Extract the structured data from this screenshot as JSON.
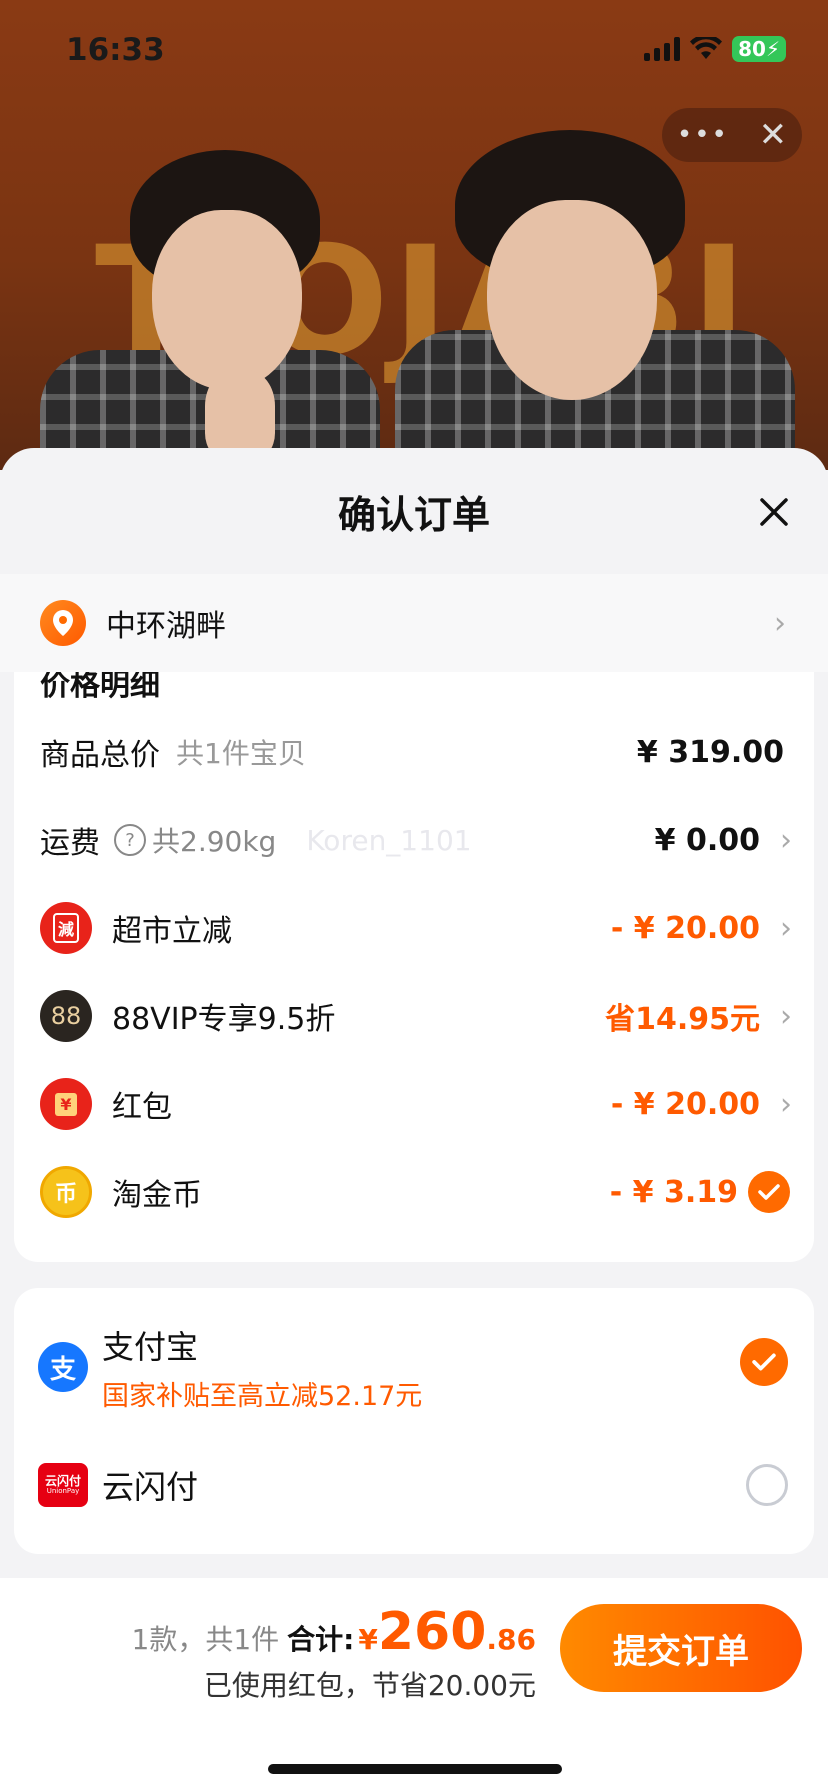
{
  "status_bar": {
    "time": "16:33",
    "battery": "80"
  },
  "hero": {
    "poster_text": "TIOJABI"
  },
  "sheet": {
    "title": "确认订单"
  },
  "address": {
    "text": "中环湖畔"
  },
  "price_detail": {
    "heading": "价格明细",
    "goods_total": {
      "label": "商品总价",
      "sub": "共1件宝贝",
      "value": "¥ 319.00"
    },
    "shipping": {
      "label": "运费",
      "sub": "共2.90kg",
      "watermark": "Koren_1101",
      "value": "¥ 0.00"
    },
    "discounts": [
      {
        "icon": "supermarket-discount-icon",
        "badge": "減",
        "label": "超市立减",
        "value": "- ¥ 20.00"
      },
      {
        "icon": "88vip-icon",
        "badge": "88",
        "label": "88VIP专享9.5折",
        "value": "省14.95元"
      },
      {
        "icon": "red-envelope-icon",
        "badge": "¥",
        "label": "红包",
        "value": "- ¥ 20.00"
      }
    ],
    "coins": {
      "label": "淘金币",
      "value": "- ¥ 3.19"
    }
  },
  "payment": {
    "alipay": {
      "name": "支付宝",
      "sub": "国家补贴至高立减52.17元",
      "icon_char": "支"
    },
    "unionpay": {
      "name": "云闪付",
      "icon_text": "云闪付",
      "icon_sub": "UnionPay"
    }
  },
  "footer": {
    "count": "1款，共1件",
    "total_label": "合计:",
    "currency": "¥",
    "amount_int": "260",
    "amount_dec": ".86",
    "saving_text": "已使用红包，节省20.00元",
    "submit_label": "提交订单"
  },
  "colors": {
    "accent": "#ff5a00",
    "check": "#ff6a00",
    "alipay": "#1677ff",
    "unionpay": "#e60012"
  }
}
